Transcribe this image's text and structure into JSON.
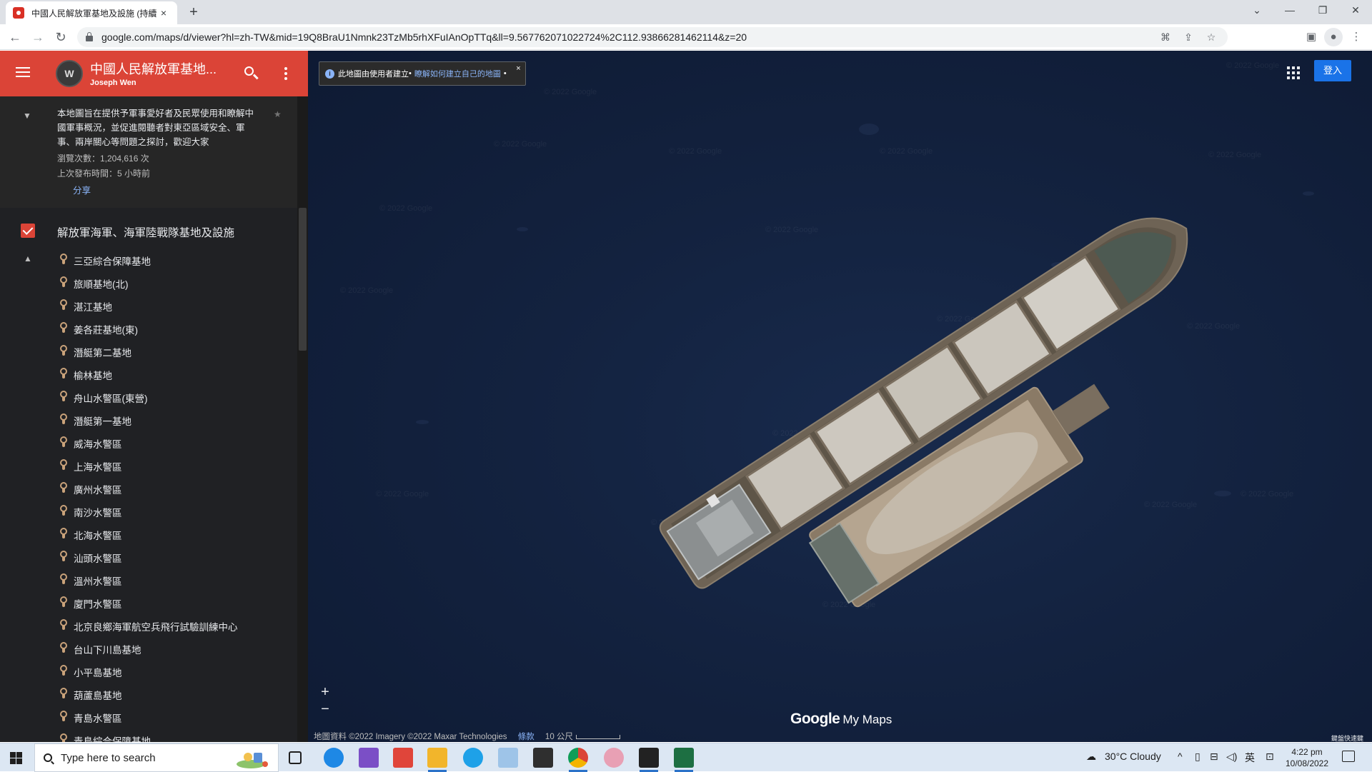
{
  "browser": {
    "tab_title": "中國人民解放軍基地及設施 (持續",
    "url": "google.com/maps/d/viewer?hl=zh-TW&mid=19Q8BraU1Nmnk23TzMb5rhXFuIAnOpTTq&ll=9.567762071022724%2C112.93866281462114&z=20",
    "new_tab_symbol": "+",
    "close_symbol": "×"
  },
  "header": {
    "title": "中國人民解放軍基地...",
    "author": "Joseph Wen",
    "avatar_letter": "W"
  },
  "description": {
    "text": "本地圖旨在提供予軍事愛好者及民眾使用和瞭解中國軍事概況，並促進閱聽者對東亞區域安全、軍事、兩岸關心等問題之探討，歡迎大家",
    "views": "瀏覽次數：1,204,616 次",
    "updated": "上次發布時間：5 小時前",
    "share": "分享",
    "star": "★"
  },
  "layer": {
    "name": "解放軍海軍、海軍陸戰隊基地及設施",
    "checked": true
  },
  "places": [
    "三亞綜合保障基地",
    "旅順基地(北)",
    "湛江基地",
    "姜各莊基地(東)",
    "潛艇第二基地",
    "榆林基地",
    "舟山水警區(東營)",
    "潛艇第一基地",
    "威海水警區",
    "上海水警區",
    "廣州水警區",
    "南沙水警區",
    "北海水警區",
    "汕頭水警區",
    "溫州水警區",
    "廈門水警區",
    "北京良鄉海軍航空兵飛行試驗訓練中心",
    "台山下川島基地",
    "小平島基地",
    "葫蘆島基地",
    "青島水警區",
    "青島綜合保障基地"
  ],
  "map": {
    "info_prefix": "此地圖由使用者建立",
    "info_link": "瞭解如何建立自己的地圖",
    "info_close": "×",
    "signin": "登入",
    "zoom_in": "+",
    "zoom_out": "−",
    "brand_google": "Google",
    "brand_mymaps": "My Maps",
    "attribution": "地圖資料 ©2022 Imagery ©2022 Maxar Technologies",
    "terms": "條款",
    "scale": "10 公尺",
    "shortcuts": "鍵盤快速鍵",
    "watermark": "© 2022 Google",
    "colors": {
      "ocean": "#13223f",
      "hull": "#6e6355",
      "cargo": "#c9c4bb",
      "barge_cargo": "#b5a590"
    }
  },
  "taskbar": {
    "search_placeholder": "Type here to search",
    "weather": "30°C  Cloudy",
    "ime": "英",
    "time": "4:22 pm",
    "date": "10/08/2022"
  }
}
